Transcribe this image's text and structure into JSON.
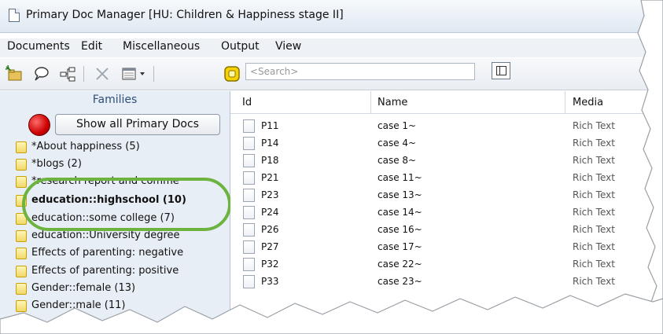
{
  "window": {
    "title": "Primary Doc Manager [HU: Children & Happiness stage II]"
  },
  "menubar": {
    "items": [
      {
        "label": "Documents"
      },
      {
        "label": "Edit"
      },
      {
        "label": "Miscellaneous"
      },
      {
        "label": "Output"
      },
      {
        "label": "View"
      }
    ]
  },
  "toolbar": {
    "buttons": [
      {
        "icon": "new-document-icon"
      },
      {
        "icon": "comment-icon"
      },
      {
        "icon": "network-icon"
      },
      {
        "icon": "delete-icon"
      },
      {
        "icon": "list-view-dropdown-icon"
      },
      {
        "icon": "filter-icon"
      }
    ],
    "search_placeholder": "<Search>",
    "layout_toggle_icon": "split-pane-icon"
  },
  "families": {
    "title": "Families",
    "show_all_label": "Show all Primary Docs",
    "items": [
      {
        "label": "*About happiness (5)",
        "bold": false
      },
      {
        "label": "*blogs (2)",
        "bold": false
      },
      {
        "label": "*research report and comme",
        "bold": false
      },
      {
        "label": "education::highschool (10)",
        "bold": true
      },
      {
        "label": "education::some college (7)",
        "bold": false
      },
      {
        "label": "education::University degree",
        "bold": false
      },
      {
        "label": "Effects of parenting: negative",
        "bold": false
      },
      {
        "label": "Effects of parenting: positive",
        "bold": false
      },
      {
        "label": "Gender::female (13)",
        "bold": false
      },
      {
        "label": "Gender::male (11)",
        "bold": false
      }
    ],
    "highlight_color": "#6db33f"
  },
  "table": {
    "columns": [
      "Id",
      "Name",
      "Media"
    ],
    "rows": [
      {
        "id": "P11",
        "name": "case 1~",
        "media": "Rich Text"
      },
      {
        "id": "P14",
        "name": "case 4~",
        "media": "Rich Text"
      },
      {
        "id": "P18",
        "name": "case 8~",
        "media": "Rich Text"
      },
      {
        "id": "P21",
        "name": "case 11~",
        "media": "Rich Text"
      },
      {
        "id": "P23",
        "name": "case 13~",
        "media": "Rich Text"
      },
      {
        "id": "P24",
        "name": "case 14~",
        "media": "Rich Text"
      },
      {
        "id": "P26",
        "name": "case 16~",
        "media": "Rich Text"
      },
      {
        "id": "P27",
        "name": "case 17~",
        "media": "Rich Text"
      },
      {
        "id": "P32",
        "name": "case 22~",
        "media": "Rich Text"
      },
      {
        "id": "P33",
        "name": "case 23~",
        "media": "Rich Text"
      }
    ]
  }
}
